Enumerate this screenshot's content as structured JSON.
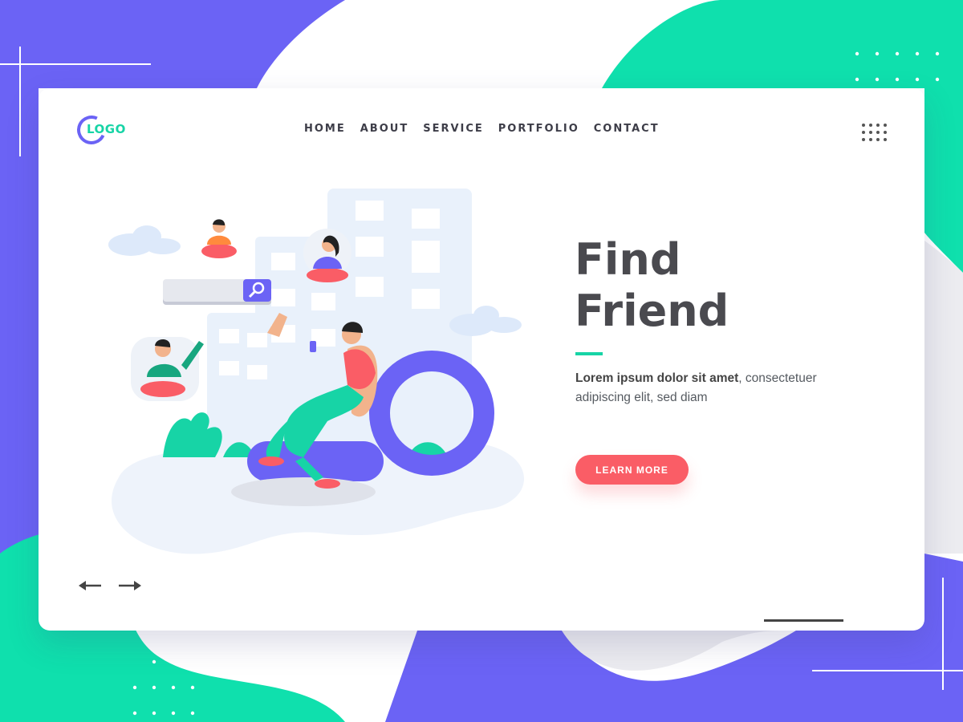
{
  "colors": {
    "accent_purple": "#6b63f5",
    "accent_green": "#17d4a6",
    "cta": "#fa5d66",
    "text_dark": "#4a4a4f"
  },
  "header": {
    "logo_text": "LOGO",
    "nav": [
      {
        "label": "HOME"
      },
      {
        "label": "ABOUT"
      },
      {
        "label": "SERVICE"
      },
      {
        "label": "PORTFOLIO"
      },
      {
        "label": "CONTACT"
      }
    ],
    "menu_icon": "grid-menu-icon"
  },
  "hero": {
    "title_line1": "Find",
    "title_line2": "Friend",
    "description_bold": "Lorem ipsum dolor sit amet",
    "description_rest": ", consectetuer adipiscing elit, sed diam",
    "cta_label": "LEARN MORE"
  },
  "footer_controls": {
    "prev_icon": "arrow-left-icon",
    "next_icon": "arrow-right-icon"
  }
}
